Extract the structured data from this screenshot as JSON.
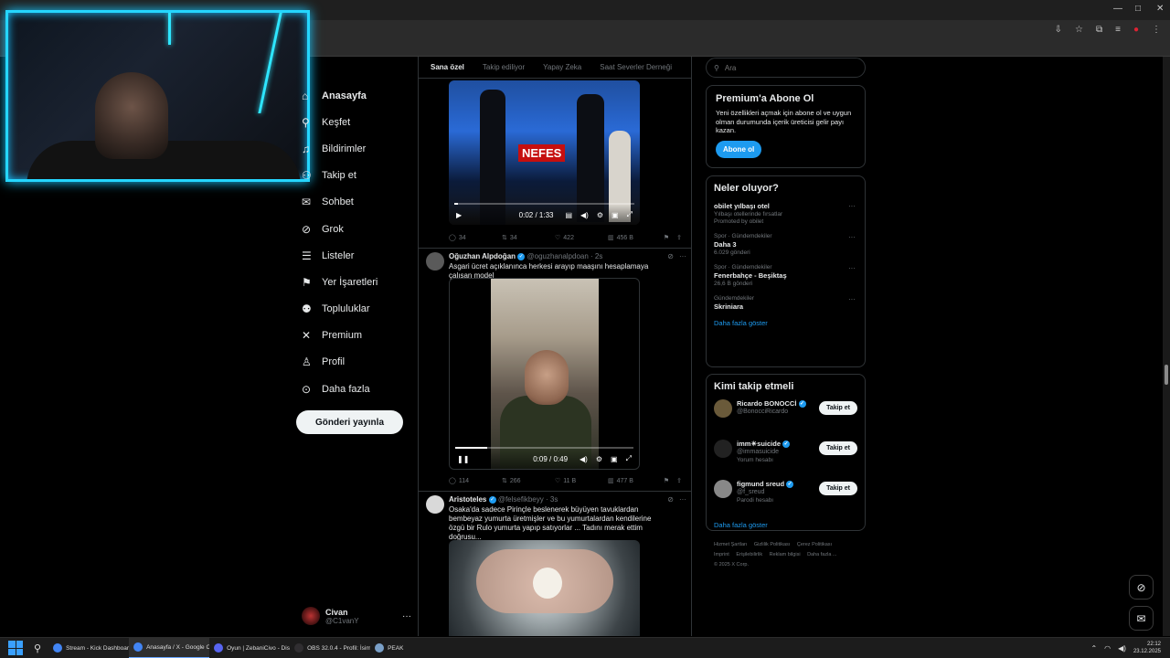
{
  "nav": {
    "items": [
      {
        "label": "Anasayfa",
        "icon": "home-icon"
      },
      {
        "label": "Keşfet",
        "icon": "search-icon"
      },
      {
        "label": "Bildirimler",
        "icon": "bell-icon"
      },
      {
        "label": "Takip et",
        "icon": "follow-icon"
      },
      {
        "label": "Sohbet",
        "icon": "mail-icon"
      },
      {
        "label": "Grok",
        "icon": "grok-icon"
      },
      {
        "label": "Listeler",
        "icon": "list-icon"
      },
      {
        "label": "Yer İşaretleri",
        "icon": "bookmark-icon"
      },
      {
        "label": "Topluluklar",
        "icon": "communities-icon"
      },
      {
        "label": "Premium",
        "icon": "x-logo-icon"
      },
      {
        "label": "Profil",
        "icon": "profile-icon"
      },
      {
        "label": "Daha fazla",
        "icon": "more-icon"
      }
    ],
    "post_button": "Gönderi yayınla",
    "profile": {
      "name": "Civan",
      "handle": "@C1vanY"
    }
  },
  "feed": {
    "tabs": [
      "Sana özel",
      "Takip ediliyor",
      "Yapay Zeka",
      "Saat Severler Derneği"
    ],
    "tweet1": {
      "overlay_text": "NEFES",
      "time": "0:02 / 1:33",
      "progress": 0.02,
      "stats": {
        "replies": "34",
        "retweets": "34",
        "likes": "422",
        "views": "456 B"
      }
    },
    "tweet2": {
      "name": "Oğuzhan Alpdoğan",
      "handle": "@oguzhanalpdoan",
      "age": "· 2s",
      "text": "Asgari ücret açıklanınca herkesi arayıp maaşını hesaplamaya çalışan model",
      "time": "0:09 / 0:49",
      "progress": 0.18,
      "stats": {
        "replies": "114",
        "retweets": "266",
        "likes": "11 B",
        "views": "477 B"
      }
    },
    "tweet3": {
      "name": "Aristoteles",
      "handle": "@felsefikbeyy",
      "age": "· 3s",
      "text": "Osaka'da sadece Pirinçle beslenerek büyüyen tavuklardan bembeyaz yumurta üretmişler ve bu yumurtalardan kendilerine özgü bir Rulo yumurta yapıp satıyorlar ... Tadını merak ettim doğrusu..."
    }
  },
  "sidebar": {
    "search_placeholder": "Ara",
    "premium": {
      "title": "Premium'a Abone Ol",
      "text": "Yeni özellikleri açmak için abone ol ve uygun olman durumunda içerik üreticisi gelir payı kazan.",
      "button": "Abone ol"
    },
    "trends": {
      "title": "Neler oluyor?",
      "items": [
        {
          "cat": "",
          "title": "obilet yılbaşı otel",
          "sub": "Yılbaşı otellerinde fırsatlar",
          "sub2": "Promoted by obilet"
        },
        {
          "cat": "Spor · Gündemdekiler",
          "title": "Daha 3",
          "sub": "6.029 gönderi",
          "sub2": ""
        },
        {
          "cat": "Spor · Gündemdekiler",
          "title": "Fenerbahçe - Beşiktaş",
          "sub": "26,6 B gönderi",
          "sub2": ""
        },
        {
          "cat": "Gündemdekiler",
          "title": "Skriniara",
          "sub": "",
          "sub2": ""
        }
      ],
      "show_more": "Daha fazla göster"
    },
    "who_to_follow": {
      "title": "Kimi takip etmeli",
      "users": [
        {
          "name": "Ricardo BONOCCİ",
          "handle": "@BonocciRicardo",
          "extra": "",
          "button": "Takip et"
        },
        {
          "name": "imm☀suicide",
          "handle": "@immasuicide",
          "extra": "Yorum hesabı",
          "button": "Takip et"
        },
        {
          "name": "figmund sreud",
          "handle": "@f_sreud",
          "extra": "Parodi hesabı",
          "button": "Takip et"
        }
      ],
      "show_more": "Daha fazla göster"
    },
    "footer": [
      "Hizmet Şartları",
      "Gizlilik Politikası",
      "Çerez Politikası",
      "Imprint",
      "Erişilebilirlik",
      "Reklam bilgisi",
      "Daha fazla ...",
      "© 2025 X Corp."
    ]
  },
  "taskbar": {
    "apps": [
      {
        "label": "Stream - Kick Dashboard",
        "color": "#4285f4",
        "active": false
      },
      {
        "label": "Anasayfa / X - Google Chrome",
        "color": "#4285f4",
        "active": true
      },
      {
        "label": "Oyun | ZebaniCivo - Discord",
        "color": "#5865f2",
        "active": false
      },
      {
        "label": "OBS 32.0.4 - Profil: İsimsiz",
        "color": "#302e31",
        "active": false
      },
      {
        "label": "PEAK",
        "color": "#7aa0c8",
        "active": false
      }
    ],
    "time": "22:12",
    "date": "23.12.2025"
  },
  "colors": {
    "accent": "#1d9bf0",
    "webcam_border": "#25d6ff",
    "background": "#000000"
  }
}
